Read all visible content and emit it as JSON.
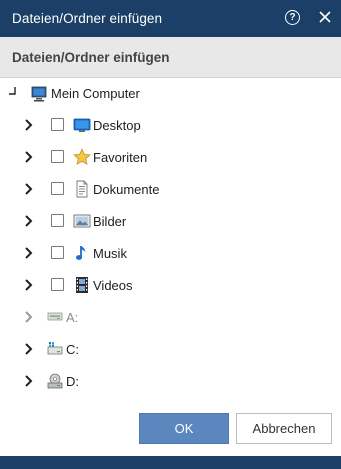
{
  "window": {
    "title": "Dateien/Ordner einfügen",
    "help_icon": "help-circle-icon",
    "close_icon": "close-icon"
  },
  "subheader": {
    "label": "Dateien/Ordner einfügen"
  },
  "tree": {
    "root": {
      "label": "Mein Computer",
      "icon": "computer-icon",
      "expanded": true
    },
    "folders": [
      {
        "label": "Desktop",
        "icon": "desktop-icon",
        "checked": false
      },
      {
        "label": "Favoriten",
        "icon": "star-icon",
        "checked": false
      },
      {
        "label": "Dokumente",
        "icon": "document-icon",
        "checked": false
      },
      {
        "label": "Bilder",
        "icon": "picture-icon",
        "checked": false
      },
      {
        "label": "Musik",
        "icon": "music-note-icon",
        "checked": false
      },
      {
        "label": "Videos",
        "icon": "film-icon",
        "checked": false
      }
    ],
    "drives": [
      {
        "label": "A:",
        "icon": "floppy-drive-icon",
        "disabled": true
      },
      {
        "label": "C:",
        "icon": "hard-drive-icon",
        "disabled": false
      },
      {
        "label": "D:",
        "icon": "cd-drive-icon",
        "disabled": false
      }
    ]
  },
  "buttons": {
    "ok": "OK",
    "cancel": "Abbrechen"
  },
  "colors": {
    "titlebar": "#1b3f66",
    "accent": "#5b87be",
    "subheader": "#e8e8e8"
  }
}
